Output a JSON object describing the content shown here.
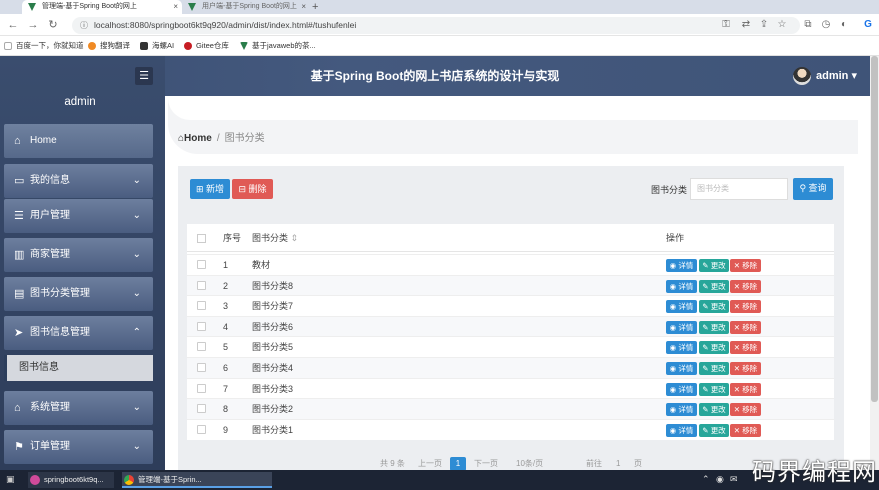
{
  "browser": {
    "tabs": [
      {
        "label": "管理端-基于Spring Boot的网上"
      },
      {
        "label": "用户端-基于Spring Boot的网上"
      }
    ],
    "new_tab_icon": "plus-icon",
    "url": "localhost:8080/springboot6kt9q920/admin/dist/index.html#/tushufenlei",
    "bookmarks": [
      "百度一下，你就知道",
      "搜狗翻译",
      "海螺AI",
      "Gitee仓库",
      "基于javaweb的茶..."
    ]
  },
  "app": {
    "title": "基于Spring Boot的网上书店系统的设计与实现",
    "user": "admin",
    "menu_toggle_icon": "menu-icon"
  },
  "sidebar": {
    "user": "admin",
    "items": [
      {
        "label": "Home",
        "icon": "home-icon"
      },
      {
        "label": "我的信息",
        "icon": "profile-icon"
      },
      {
        "label": "用户管理",
        "icon": "sliders-icon"
      },
      {
        "label": "商家管理",
        "icon": "chart-icon"
      },
      {
        "label": "图书分类管理",
        "icon": "print-icon"
      },
      {
        "label": "图书信息管理",
        "icon": "send-icon"
      },
      {
        "label": "系统管理",
        "icon": "bank-icon"
      },
      {
        "label": "订单管理",
        "icon": "flag-icon"
      }
    ],
    "sub_item": "图书信息"
  },
  "breadcrumb": {
    "home": "Home",
    "separator": "/",
    "current": "图书分类"
  },
  "toolbar": {
    "add_label": "新增",
    "delete_label": "删除",
    "search_label": "图书分类",
    "search_placeholder": "图书分类",
    "search_button": "查询"
  },
  "table": {
    "headers": [
      "序号",
      "图书分类",
      "操作"
    ],
    "sort_icon": "sort-icon",
    "rows": [
      {
        "seq": "1",
        "name": "教材"
      },
      {
        "seq": "2",
        "name": "图书分类8"
      },
      {
        "seq": "3",
        "name": "图书分类7"
      },
      {
        "seq": "4",
        "name": "图书分类6"
      },
      {
        "seq": "5",
        "name": "图书分类5"
      },
      {
        "seq": "6",
        "name": "图书分类4"
      },
      {
        "seq": "7",
        "name": "图书分类3"
      },
      {
        "seq": "8",
        "name": "图书分类2"
      },
      {
        "seq": "9",
        "name": "图书分类1"
      }
    ],
    "actions": {
      "detail": "详情",
      "edit": "更改",
      "remove": "移除"
    }
  },
  "pager": {
    "total": "共 9 条",
    "prev": "上一页",
    "current": "1",
    "next": "下一页",
    "page_size": "10条/页",
    "goto": "前往",
    "goto_value": "1",
    "page_unit": "页"
  },
  "taskbar": {
    "items": [
      "springboot6kt9q...",
      "管理端-基于Sprin..."
    ]
  },
  "watermark": "码界编程网",
  "colors": {
    "primary": "#2d8cd4",
    "danger": "#e05a55",
    "teal": "#27a69a",
    "sidebar": "#3a4d6e"
  }
}
